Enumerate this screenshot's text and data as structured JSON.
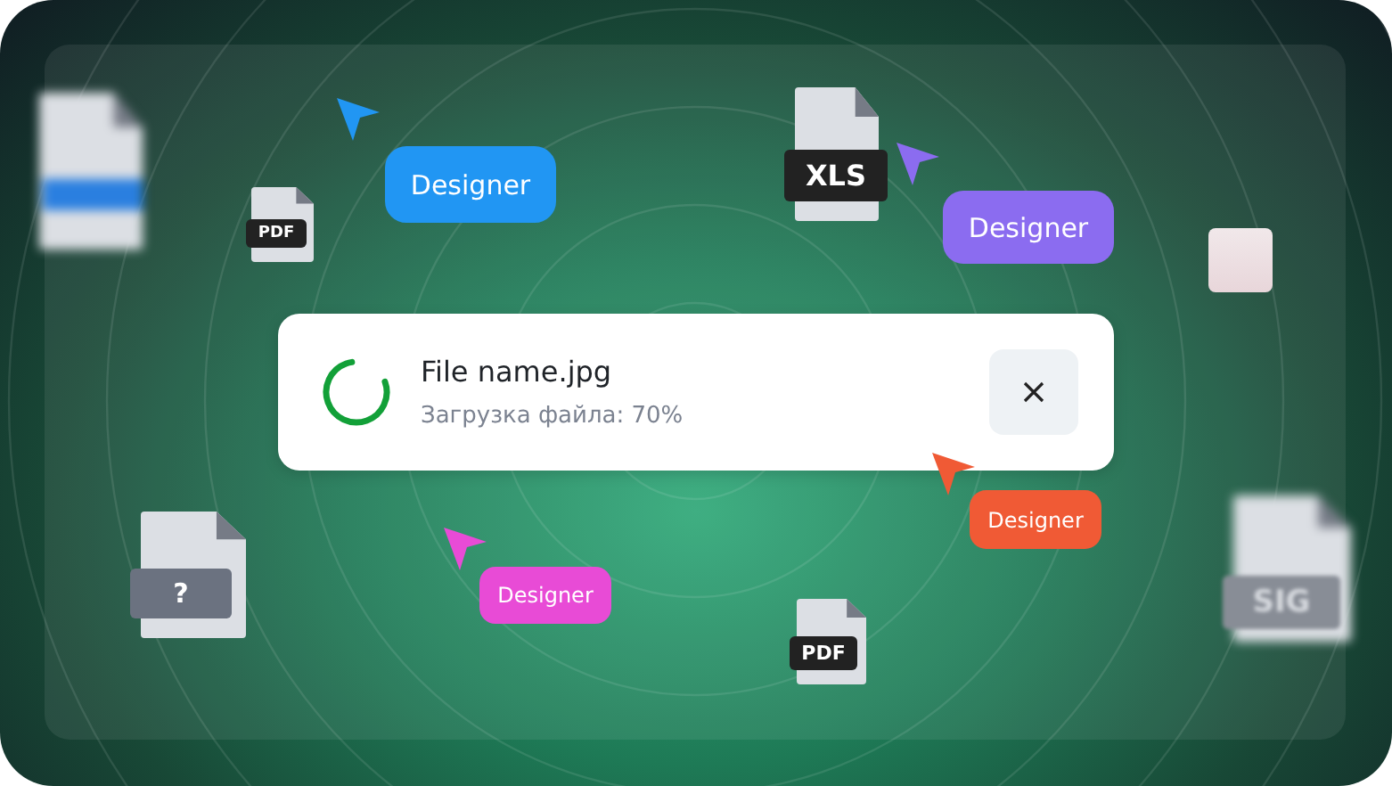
{
  "upload_card": {
    "file_name": "File name.jpg",
    "status": "Загрузка файла: 70%"
  },
  "cursors": [
    {
      "label": "Designer",
      "color": "#2196f3"
    },
    {
      "label": "Designer",
      "color": "#8b6cf0"
    },
    {
      "label": "Designer",
      "color": "#f05a35"
    },
    {
      "label": "Designer",
      "color": "#e84bd6"
    }
  ],
  "file_icons": [
    {
      "kind": "blurred"
    },
    {
      "kind": "clear",
      "label": "PDF"
    },
    {
      "kind": "clear",
      "label": "XLS"
    },
    {
      "kind": "clear",
      "label": "?"
    },
    {
      "kind": "clear",
      "label": "PDF"
    },
    {
      "kind": "blurred",
      "label": "SIG"
    }
  ],
  "thumbnail": {
    "kind": "photo"
  }
}
